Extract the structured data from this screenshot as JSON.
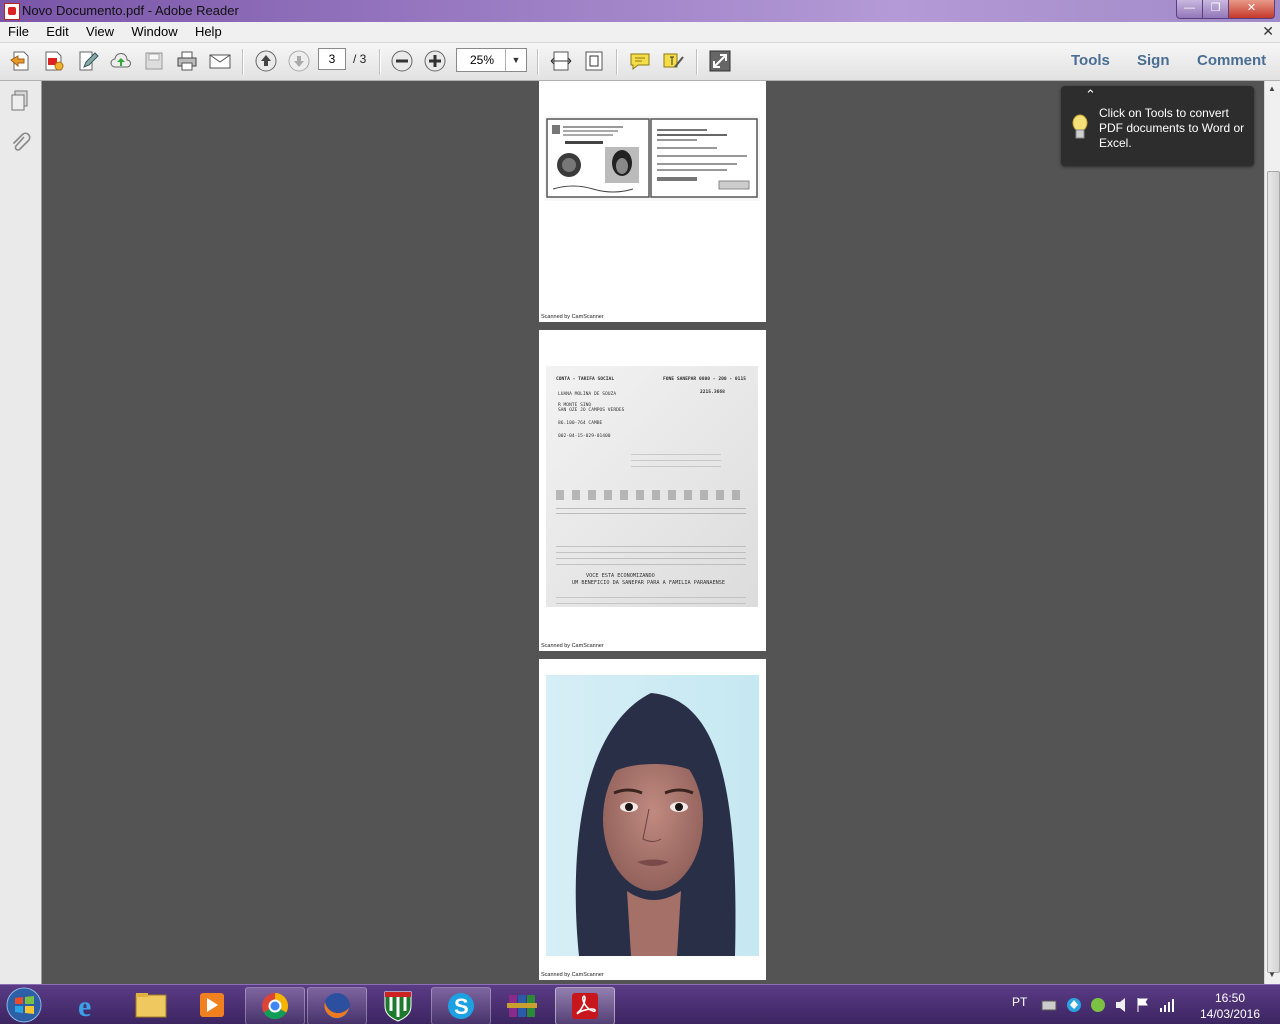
{
  "window": {
    "title": "Novo Documento.pdf - Adobe Reader"
  },
  "menu": [
    "File",
    "Edit",
    "View",
    "Window",
    "Help"
  ],
  "toolbar": {
    "current_page": "3",
    "page_total": "/ 3",
    "zoom": "25%",
    "tools_label": "Tools",
    "sign_label": "Sign",
    "comment_label": "Comment"
  },
  "tooltip": {
    "text": "Click on Tools to convert PDF documents to Word or Excel."
  },
  "pages": [
    {
      "footer": "Scanned by CamScanner"
    },
    {
      "footer": "Scanned by CamScanner",
      "bill": {
        "header_left": "CONTA - TARIFA SOCIAL",
        "header_right": "FONE SANEPAR 0800 - 200 - 0115",
        "name": "LUANA MOLINA DE SOUZA",
        "code": "2215.3668",
        "line1": "R MONTE SINO",
        "line2": "SAN OZE JO CAMPOS VERDES",
        "line3": "86.100-764 CAMBE",
        "line4": "002-04-15-029-01400",
        "promo1": "VOCE ESTA ECONOMIZANDO",
        "promo2": "UM BENEFICIO DA SANEPAR PARA A FAMILIA PARANAENSE"
      }
    },
    {
      "footer": "Scanned by CamScanner"
    }
  ],
  "taskbar": {
    "language": "PT",
    "time": "16:50",
    "date": "14/03/2016"
  },
  "colors": {
    "title_bar": "#9b7dc4",
    "taskbar": "#4a2f70",
    "link": "#4a6d93",
    "doc_bg": "#545454"
  }
}
